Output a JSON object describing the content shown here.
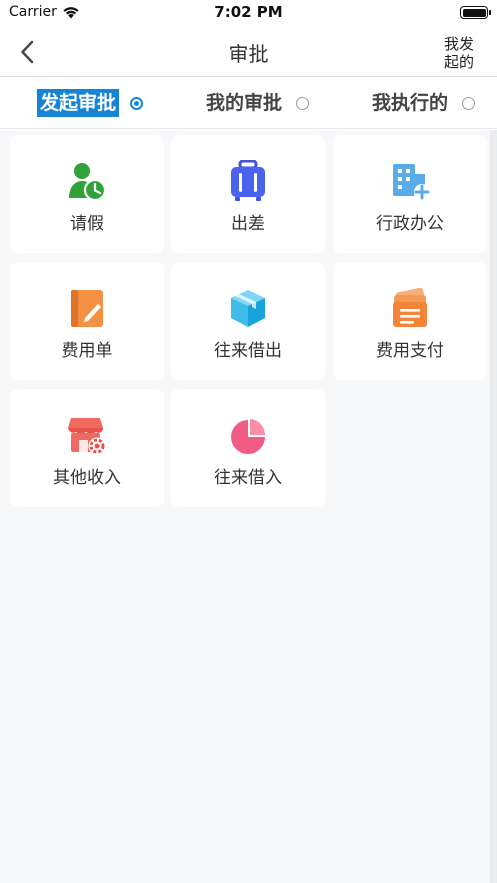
{
  "status_bar": {
    "carrier": "Carrier",
    "time": "7:02 PM"
  },
  "nav": {
    "title": "审批",
    "right_label_line1": "我发",
    "right_label_line2": "起的"
  },
  "tabs": [
    {
      "label": "发起审批",
      "selected": true
    },
    {
      "label": "我的审批",
      "selected": false
    },
    {
      "label": "我执行的",
      "selected": false
    }
  ],
  "colors": {
    "accent": "#1584d6",
    "background": "#f7f8fa"
  },
  "items": [
    {
      "label": "请假",
      "icon": "person-clock-icon"
    },
    {
      "label": "出差",
      "icon": "suitcase-icon"
    },
    {
      "label": "行政办公",
      "icon": "building-add-icon"
    },
    {
      "label": "费用单",
      "icon": "notebook-pen-icon"
    },
    {
      "label": "往来借出",
      "icon": "box-icon"
    },
    {
      "label": "费用支付",
      "icon": "card-stack-icon"
    },
    {
      "label": "其他收入",
      "icon": "store-gear-icon"
    },
    {
      "label": "往来借入",
      "icon": "pie-chart-icon"
    }
  ]
}
